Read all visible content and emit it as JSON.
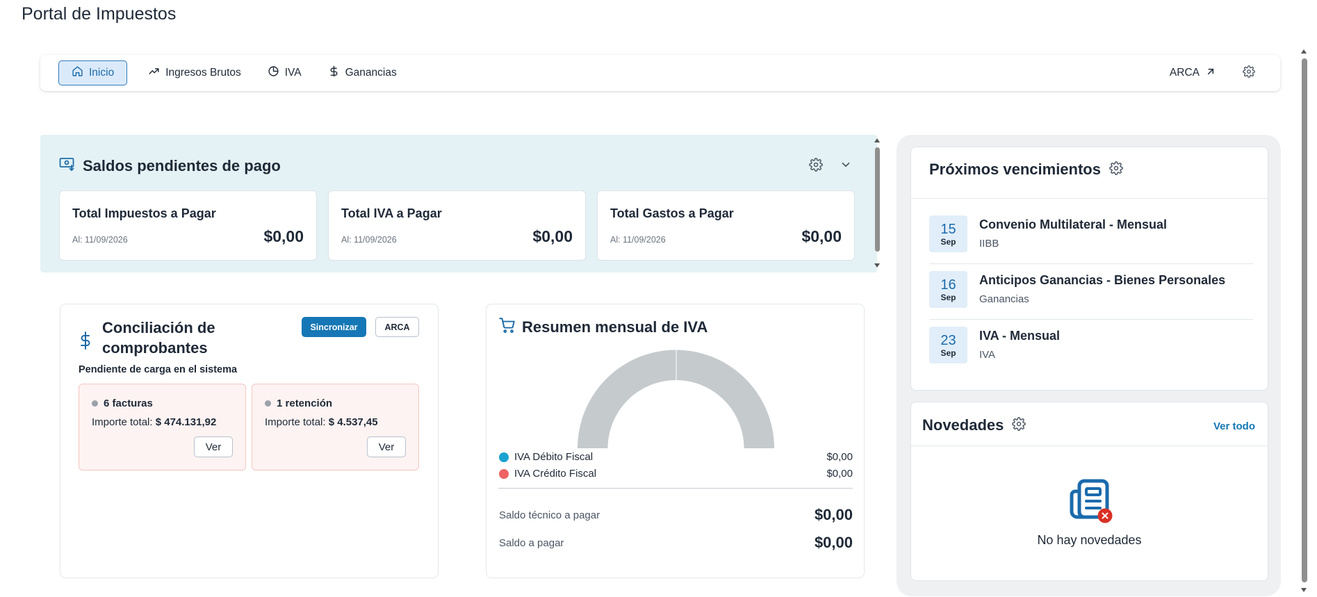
{
  "page": {
    "title": "Portal de Impuestos"
  },
  "nav": {
    "items": [
      {
        "label": "Inicio",
        "icon": "home-icon"
      },
      {
        "label": "Ingresos Brutos",
        "icon": "trending-up-icon"
      },
      {
        "label": "IVA",
        "icon": "pie-chart-icon"
      },
      {
        "label": "Ganancias",
        "icon": "dollar-icon"
      }
    ],
    "arca_label": "ARCA"
  },
  "saldos": {
    "title": "Saldos pendientes de pago",
    "cards": [
      {
        "label": "Total Impuestos a Pagar",
        "date": "Al: 11/09/2026",
        "amount": "$0,00"
      },
      {
        "label": "Total IVA a Pagar",
        "date": "Al: 11/09/2026",
        "amount": "$0,00"
      },
      {
        "label": "Total Gastos a Pagar",
        "date": "Al: 11/09/2026",
        "amount": "$0,00"
      }
    ]
  },
  "conciliacion": {
    "title": "Conciliación de comprobantes",
    "sync_label": "Sincronizar",
    "arca_label": "ARCA",
    "pending_label": "Pendiente de carga en el sistema",
    "boxes": [
      {
        "label": "6 facturas",
        "importe_label": "Importe total:",
        "importe_value": "$ 474.131,92",
        "ver_label": "Ver"
      },
      {
        "label": "1 retención",
        "importe_label": "Importe total:",
        "importe_value": "$ 4.537,45",
        "ver_label": "Ver"
      }
    ]
  },
  "iva_resumen": {
    "title": "Resumen mensual de IVA",
    "legend": [
      {
        "label": "IVA Débito Fiscal",
        "value": "$0,00",
        "color": "#1aa3d1"
      },
      {
        "label": "IVA Crédito Fiscal",
        "value": "$0,00",
        "color": "#ef6363"
      }
    ],
    "gauge_color": "#c5cacd",
    "totals": [
      {
        "label": "Saldo técnico a pagar",
        "value": "$0,00"
      },
      {
        "label": "Saldo a pagar",
        "value": "$0,00"
      }
    ]
  },
  "vencimientos": {
    "title": "Próximos vencimientos",
    "items": [
      {
        "day": "15",
        "month": "Sep",
        "name": "Convenio Multilateral - Mensual",
        "sub": "IIBB"
      },
      {
        "day": "16",
        "month": "Sep",
        "name": "Anticipos Ganancias - Bienes Personales",
        "sub": "Ganancias"
      },
      {
        "day": "23",
        "month": "Sep",
        "name": "IVA - Mensual",
        "sub": "IVA"
      }
    ]
  },
  "novedades": {
    "title": "Novedades",
    "ver_todo": "Ver todo",
    "empty_text": "No hay novedades"
  },
  "colors": {
    "accent": "#1577b5",
    "panel_bg": "#e4f2f5",
    "badge_red": "#d93025"
  }
}
